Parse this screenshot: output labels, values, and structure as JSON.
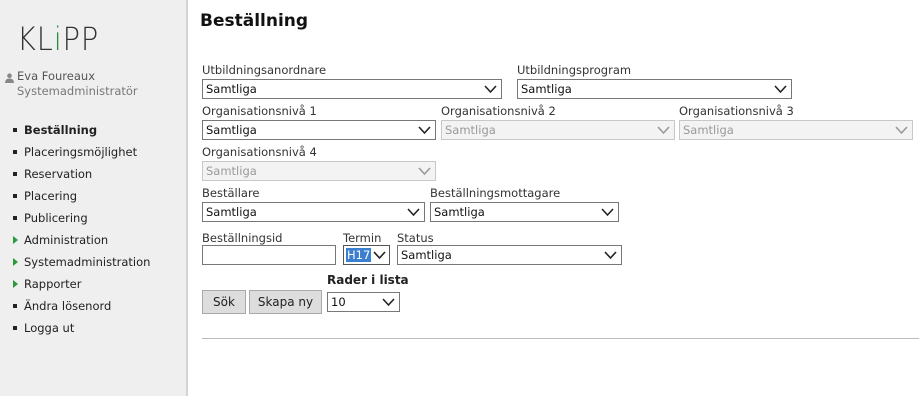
{
  "app": {
    "logo_text_left": "KL",
    "logo_text_i": "i",
    "logo_text_right": "PP"
  },
  "user": {
    "name": "Eva Foureaux",
    "role": "Systemadministratör"
  },
  "nav": {
    "items": [
      {
        "label": "Beställning"
      },
      {
        "label": "Placeringsmöjlighet"
      },
      {
        "label": "Reservation"
      },
      {
        "label": "Placering"
      },
      {
        "label": "Publicering"
      },
      {
        "label": "Administration"
      },
      {
        "label": "Systemadministration"
      },
      {
        "label": "Rapporter"
      },
      {
        "label": "Ändra lösenord"
      },
      {
        "label": "Logga ut"
      }
    ]
  },
  "page": {
    "title": "Beställning"
  },
  "form": {
    "utbildningsanordnare": {
      "label": "Utbildningsanordnare",
      "value": "Samtliga"
    },
    "utbildningsprogram": {
      "label": "Utbildningsprogram",
      "value": "Samtliga"
    },
    "org1": {
      "label": "Organisationsnivå 1",
      "value": "Samtliga"
    },
    "org2": {
      "label": "Organisationsnivå 2",
      "value": "Samtliga"
    },
    "org3": {
      "label": "Organisationsnivå 3",
      "value": "Samtliga"
    },
    "org4": {
      "label": "Organisationsnivå 4",
      "value": "Samtliga"
    },
    "bestallare": {
      "label": "Beställare",
      "value": "Samtliga"
    },
    "mottagare": {
      "label": "Beställningsmottagare",
      "value": "Samtliga"
    },
    "bestallningsid": {
      "label": "Beställningsid",
      "value": ""
    },
    "termin": {
      "label": "Termin",
      "value": "H17"
    },
    "status": {
      "label": "Status",
      "value": "Samtliga"
    },
    "rader": {
      "label": "Rader i lista",
      "value": "10"
    }
  },
  "buttons": {
    "search": "Sök",
    "create": "Skapa ny"
  }
}
